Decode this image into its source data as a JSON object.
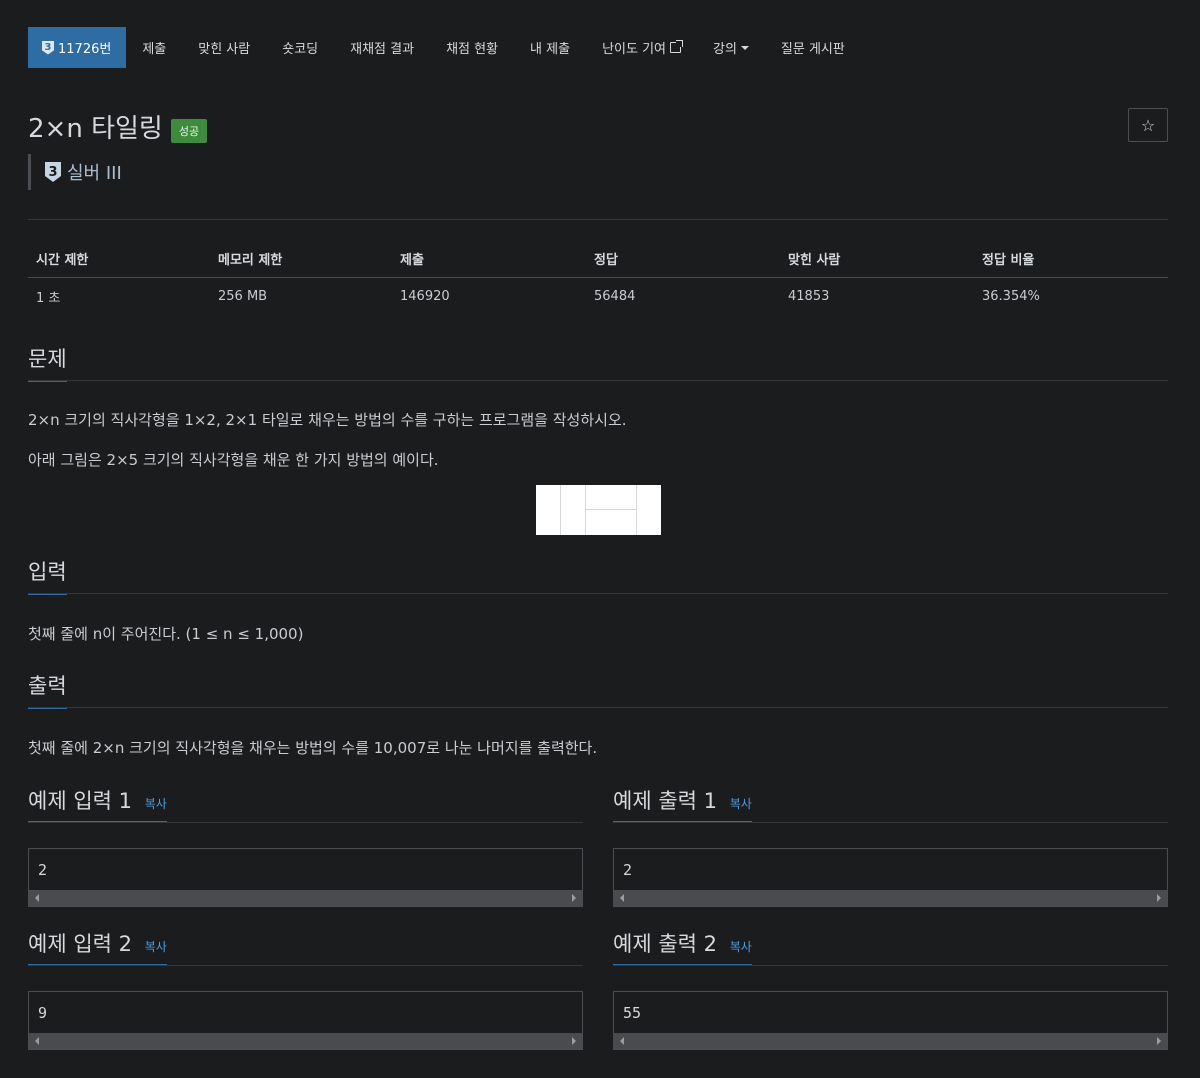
{
  "nav": {
    "problem_number": "11726번",
    "tier_badge_digit": "3",
    "items": [
      "제출",
      "맞힌 사람",
      "숏코딩",
      "재채점 결과",
      "채점 현황",
      "내 제출",
      "난이도 기여",
      "강의",
      "질문 게시판"
    ]
  },
  "header": {
    "title": "2×n 타일링",
    "status": "성공",
    "tier": "실버 III",
    "tier_digit": "3",
    "star": "☆"
  },
  "info": {
    "headers": [
      "시간 제한",
      "메모리 제한",
      "제출",
      "정답",
      "맞힌 사람",
      "정답 비율"
    ],
    "values": [
      "1 초",
      "256 MB",
      "146920",
      "56484",
      "41853",
      "36.354%"
    ]
  },
  "sections": {
    "problem_title": "문제",
    "problem_text_1": "2×n 크기의 직사각형을 1×2, 2×1 타일로 채우는 방법의 수를 구하는 프로그램을 작성하시오.",
    "problem_text_2": "아래 그림은 2×5 크기의 직사각형을 채운 한 가지 방법의 예이다.",
    "input_title": "입력",
    "input_text": "첫째 줄에 n이 주어진다. (1 ≤ n ≤ 1,000)",
    "output_title": "출력",
    "output_text": "첫째 줄에 2×n 크기의 직사각형을 채우는 방법의 수를 10,007로 나눈 나머지를 출력한다."
  },
  "samples": {
    "copy_label": "복사",
    "input1_title": "예제 입력 1",
    "output1_title": "예제 출력 1",
    "input2_title": "예제 입력 2",
    "output2_title": "예제 출력 2",
    "input1": "2",
    "output1": "2",
    "input2": "9",
    "output2": "55"
  },
  "colors": {
    "background": "#1b1c1e",
    "accent": "#2e6da4",
    "success": "#3c8c3c",
    "link": "#4a9fe0"
  }
}
